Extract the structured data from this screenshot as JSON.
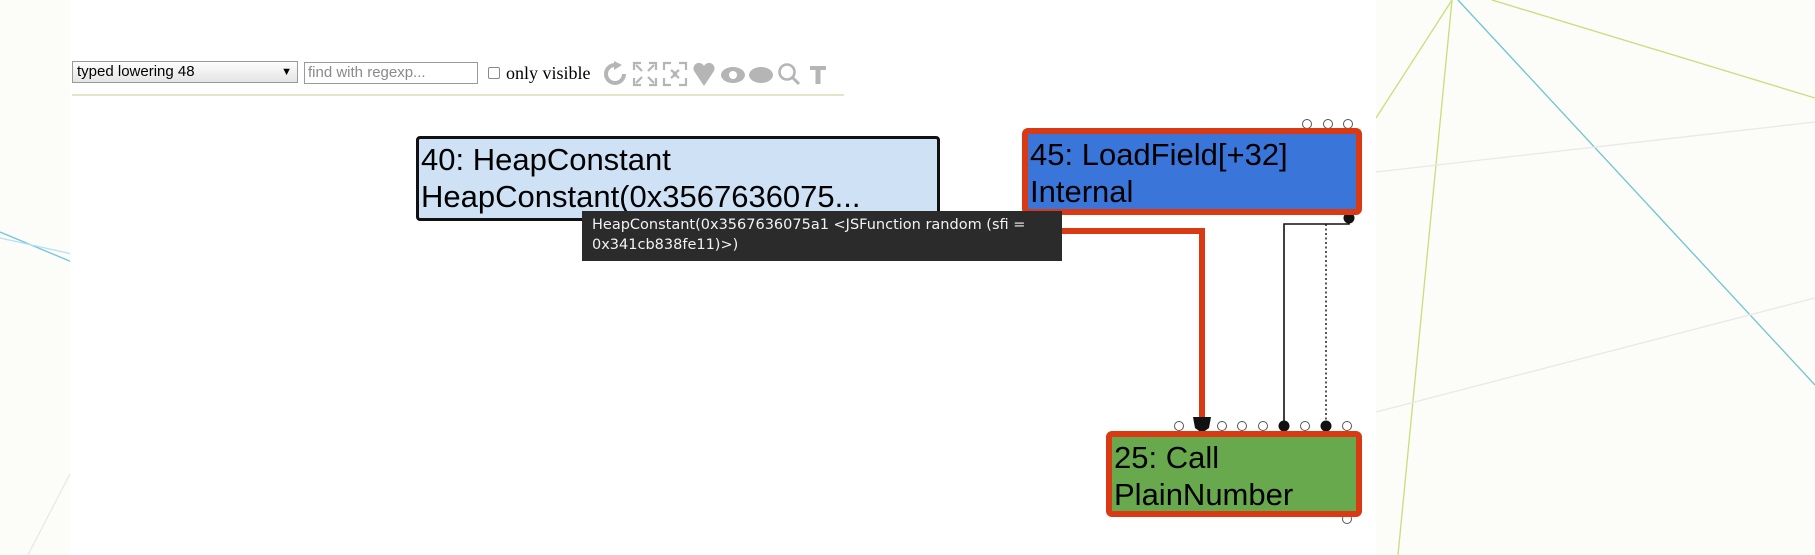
{
  "toolbar": {
    "phase_select": "typed lowering 48",
    "search_placeholder": "find with regexp...",
    "only_visible_label": "only visible",
    "icons": [
      "refresh-icon",
      "expand-icon",
      "collapse-icon",
      "heart-icon",
      "eye-icon",
      "hide-icon",
      "search-icon",
      "text-icon"
    ]
  },
  "nodes": {
    "n40": {
      "line1": "40: HeapConstant",
      "line2": "HeapConstant(0x3567636075..."
    },
    "n45": {
      "line1": "45: LoadField[+32]",
      "line2": "Internal"
    },
    "n25": {
      "line1": "25: Call",
      "line2": "PlainNumber"
    }
  },
  "tooltip": {
    "line1": "HeapConstant(0x3567636075a1 <JSFunction random (sfi =",
    "line2": "0x341cb838fe11)>)"
  },
  "colors": {
    "node_heap_constant": "#cfe2f5",
    "node_load_field": "#3a76d9",
    "node_call": "#68a94d",
    "selected_border": "#d93a14",
    "tooltip_bg": "#2b2b2b"
  }
}
